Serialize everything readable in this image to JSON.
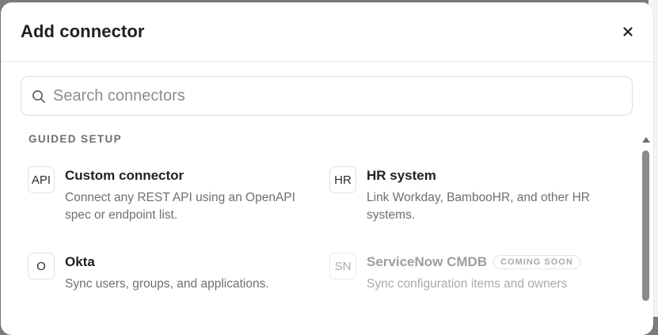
{
  "modal": {
    "title": "Add connector",
    "close_label": "×"
  },
  "search": {
    "placeholder": "Search connectors",
    "value": ""
  },
  "section": {
    "label": "GUIDED SETUP"
  },
  "connectors": [
    {
      "badge": "API",
      "title": "Custom connector",
      "description": "Connect any REST API using an OpenAPI spec or endpoint list."
    },
    {
      "badge": "HR",
      "title": "HR system",
      "description": "Link Workday, BambooHR, and other HR systems."
    },
    {
      "badge": "O",
      "title": "Okta",
      "description": "Sync users, groups, and applications."
    },
    {
      "badge": "SN",
      "title": "ServiceNow CMDB",
      "status": "COMING SOON",
      "description": "Sync configuration items and owners"
    }
  ],
  "icons": {
    "search": "search-icon",
    "close": "close-icon",
    "scroll_up": "chevron-up-icon"
  },
  "colors": {
    "overlay": "#7c7c7c",
    "text_primary": "#1f2024",
    "text_secondary": "#6b6f76",
    "disabled": "#a7aab0"
  }
}
